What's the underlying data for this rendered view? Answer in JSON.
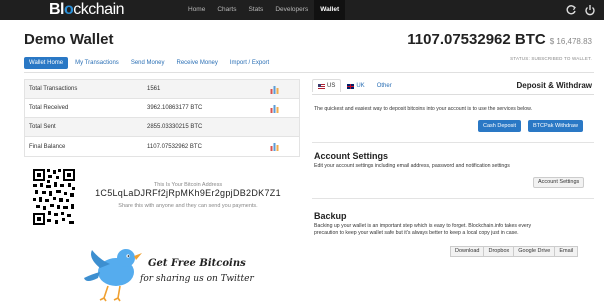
{
  "navbar": {
    "logo": {
      "part1": "Bl",
      "part2": "o",
      "part3": "ckchain"
    },
    "items": [
      {
        "label": "Home",
        "active": false
      },
      {
        "label": "Charts",
        "active": false
      },
      {
        "label": "Stats",
        "active": false
      },
      {
        "label": "Developers",
        "active": false
      },
      {
        "label": "Wallet",
        "active": true
      }
    ]
  },
  "header": {
    "title": "Demo Wallet",
    "balance_btc": "1107.07532962 BTC",
    "balance_usd": "$ 16,478.83",
    "status": "STATUS: SUBSCRIBED TO WALLET."
  },
  "tabs": [
    {
      "label": "Wallet Home",
      "active": true
    },
    {
      "label": "My Transactions",
      "active": false
    },
    {
      "label": "Send Money",
      "active": false
    },
    {
      "label": "Receive Money",
      "active": false
    },
    {
      "label": "Import / Export",
      "active": false
    }
  ],
  "stats": [
    {
      "label": "Total Transactions",
      "value": "1561"
    },
    {
      "label": "Total Received",
      "value": "3962.10863177 BTC"
    },
    {
      "label": "Total Sent",
      "value": "2855.03330215 BTC"
    },
    {
      "label": "Final Balance",
      "value": "1107.07532962 BTC"
    }
  ],
  "address": {
    "label": "This Is Your Bitcoin Address",
    "value": "1C5LqLaDJRFf2jRpMKh9Er2gpjDB2DK7Z1",
    "hint": "Share this with anyone and they can send you payments."
  },
  "promo": {
    "title": "Get Free Bitcoins",
    "subtitle": "for sharing us on Twitter"
  },
  "deposit": {
    "tabs": [
      {
        "label": "US",
        "active": true
      },
      {
        "label": "UK",
        "active": false
      },
      {
        "label": "Other",
        "active": false
      }
    ],
    "heading": "Deposit & Withdraw",
    "description": "The quickest and easiest way to deposit bitcoins into your account is to use the services below.",
    "cash_button": "Cash Deposit",
    "btcpak_button": "BTCPak Withdraw"
  },
  "account_settings": {
    "title": "Account Settings",
    "description": "Edit your account settings including email address, password and notification settings",
    "button": "Account Settings"
  },
  "backup": {
    "title": "Backup",
    "description_line1": "Backing up your wallet is an important step which is easy to forget. Blockchain.info takes every",
    "description_line2": "precaution to keep your wallet safe but it's always better to keep a local copy just in case.",
    "buttons": [
      "Download",
      "Dropbox",
      "Google Drive",
      "Email"
    ]
  },
  "colors": {
    "navbar_bg": "#1f1f1f",
    "brand_blue": "#2b8fd6",
    "button_blue": "#2a78c5",
    "link_blue": "#2a6fb5"
  }
}
